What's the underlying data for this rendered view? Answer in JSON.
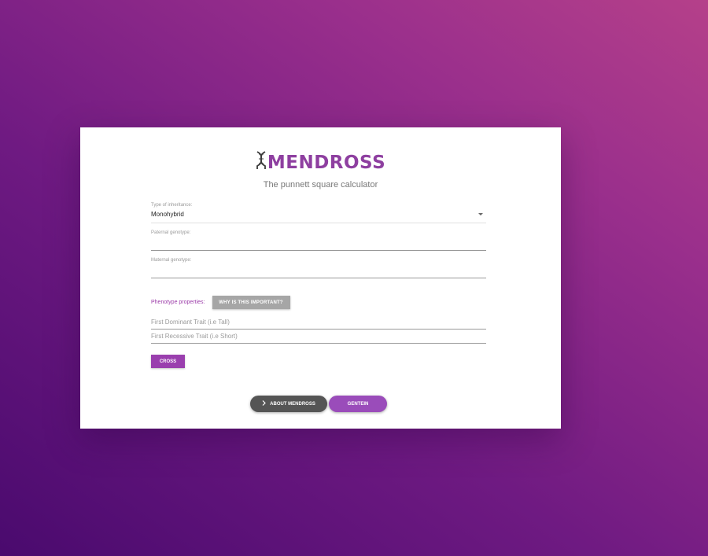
{
  "app": {
    "logo_text": "MENDROSS",
    "tagline": "The punnett square calculator"
  },
  "form": {
    "inheritance_label": "Type of inheritance:",
    "inheritance_value": "Monohybrid",
    "paternal_label": "Paternal genotype:",
    "paternal_value": "",
    "maternal_label": "Maternal genotype:",
    "maternal_value": "",
    "phenotype_label": "Phenotype properties:",
    "why_button": "WHY IS THIS IMPORTANT?",
    "dominant_placeholder": "First Dominant Trait (i.e Tall)",
    "recessive_placeholder": "First Recessive Trait (i.e Short)",
    "cross_button": "CROSS"
  },
  "footer": {
    "about_button": "ABOUT MENDROSS",
    "about_icon": "chevron-right-icon",
    "gentein_button": "GENTEIN"
  },
  "colors": {
    "accent": "#9a3fae",
    "logo": "#8e3fa0",
    "dark_button": "#555555",
    "gray_button": "#a6a6a6"
  }
}
